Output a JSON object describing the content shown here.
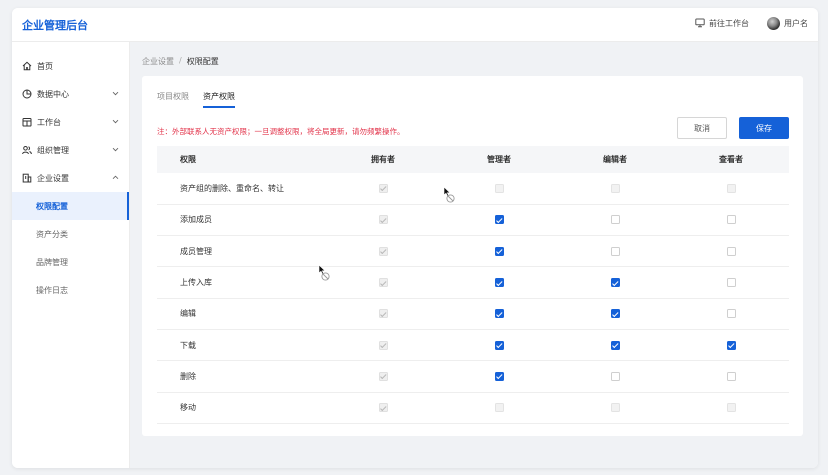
{
  "header": {
    "brand": "企业管理后台",
    "workbench_link": "前往工作台",
    "username": "用户名"
  },
  "sidebar": {
    "items": [
      {
        "label": "首页",
        "icon": "home-icon"
      },
      {
        "label": "数据中心",
        "icon": "pie-chart-icon"
      },
      {
        "label": "工作台",
        "icon": "calendar-icon"
      },
      {
        "label": "组织管理",
        "icon": "users-icon"
      },
      {
        "label": "企业设置",
        "icon": "building-icon"
      }
    ],
    "subitems": [
      {
        "label": "权限配置"
      },
      {
        "label": "资产分类"
      },
      {
        "label": "品牌管理"
      },
      {
        "label": "操作日志"
      }
    ]
  },
  "breadcrumb": {
    "parent": "企业设置",
    "separator": "/",
    "current": "权限配置"
  },
  "tabs": [
    {
      "label": "项目权限"
    },
    {
      "label": "资产权限"
    }
  ],
  "notice": "注：外部联系人无资产权限；一旦调整权限，将全局更新，请勿频繁操作。",
  "buttons": {
    "cancel": "取消",
    "save": "保存"
  },
  "table": {
    "headers": [
      "权限",
      "拥有者",
      "管理者",
      "编辑者",
      "查看者"
    ],
    "rows": [
      {
        "label": "资产组的删除、重命名、转让",
        "cells": [
          "disabled-checked",
          "disabled",
          "disabled",
          "disabled"
        ]
      },
      {
        "label": "添加成员",
        "cells": [
          "disabled-checked",
          "checked",
          "unchecked",
          "unchecked"
        ]
      },
      {
        "label": "成员管理",
        "cells": [
          "disabled-checked",
          "checked",
          "unchecked",
          "unchecked"
        ]
      },
      {
        "label": "上传入库",
        "cells": [
          "disabled-checked",
          "checked",
          "checked",
          "unchecked"
        ]
      },
      {
        "label": "编辑",
        "cells": [
          "disabled-checked",
          "checked",
          "checked",
          "unchecked"
        ]
      },
      {
        "label": "下载",
        "cells": [
          "disabled-checked",
          "checked",
          "checked",
          "checked"
        ]
      },
      {
        "label": "删除",
        "cells": [
          "disabled-checked",
          "checked",
          "unchecked",
          "unchecked"
        ]
      },
      {
        "label": "移动",
        "cells": [
          "disabled-checked",
          "disabled",
          "disabled",
          "disabled"
        ]
      }
    ]
  },
  "colors": {
    "accent": "#1561d8",
    "notice": "#e2334a"
  }
}
